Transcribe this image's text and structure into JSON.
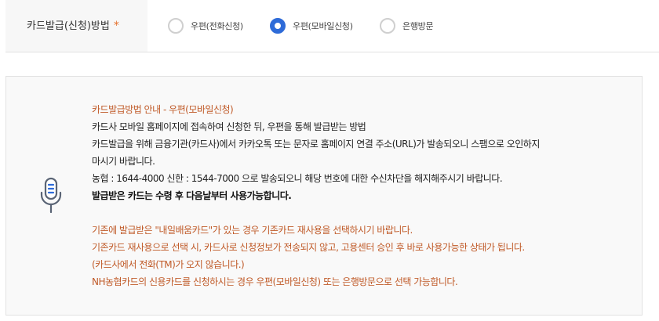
{
  "form": {
    "label": "카드발급(신청)방법",
    "required_mark": "*",
    "options": [
      {
        "label": "우편(전화신청)",
        "selected": false
      },
      {
        "label": "우편(모바일신청)",
        "selected": true
      },
      {
        "label": "은행방문",
        "selected": false
      }
    ]
  },
  "info": {
    "icon": "microphone-icon",
    "heading": "카드발급방법 안내 - 우편(모바일신청)",
    "lines": [
      "카드사 모바일 홈페이지에 접속하여 신청한 뒤, 우편을 통해 발급받는 방법",
      "카드발급을 위해 금융기관(카드사)에서 카카오톡 또는 문자로 홈페이지 연결 주소(URL)가 발송되오니 스팸으로 오인하지",
      "마시기 바랍니다.",
      "농협 : 1644-4000 신한 : 1544-7000 으로 발송되오니 해당 번호에 대한 수신차단을 해지해주시기 바랍니다."
    ],
    "bold_line": "발급받은 카드는 수령 후 다음날부터 사용가능합니다.",
    "notice_lines": [
      "기존에 발급받은 \"내일배움카드\"가 있는 경우 기존카드 재사용을 선택하시기 바랍니다.",
      "기존카드 재사용으로 선택 시, 카드사로 신청정보가 전송되지 않고, 고용센터 승인 후 바로 사용가능한 상태가 됩니다.",
      "(카드사에서 전화(TM)가 오지 않습니다.)",
      "NH농협카드의 신용카드를 신청하시는 경우 우편(모바일신청) 또는 은행방문으로 선택 가능합니다."
    ]
  },
  "colors": {
    "accent": "#2e6bd8",
    "notice": "#c05a28",
    "required": "#e5702c"
  }
}
